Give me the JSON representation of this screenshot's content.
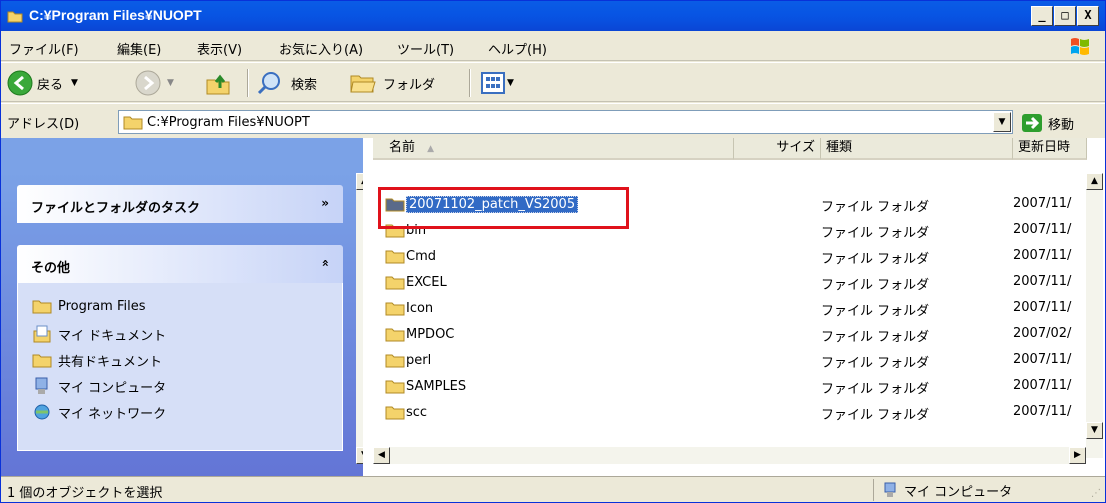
{
  "window": {
    "title": "C:¥Program Files¥NUOPT",
    "buttons": [
      "_",
      "□",
      "X"
    ]
  },
  "menu": [
    "ファイル(F)",
    "編集(E)",
    "表示(V)",
    "お気に入り(A)",
    "ツール(T)",
    "ヘルプ(H)"
  ],
  "toolbar": {
    "back": "戻る",
    "search": "検索",
    "folders": "フォルダ"
  },
  "address": {
    "label": "アドレス(D)",
    "value": "C:¥Program Files¥NUOPT",
    "go": "移動"
  },
  "tasks": {
    "file_folder_tasks": "ファイルとフォルダのタスク",
    "other": "その他",
    "other_items": [
      "Program Files",
      "マイ ドキュメント",
      "共有ドキュメント",
      "マイ コンピュータ",
      "マイ ネットワーク"
    ]
  },
  "columns": {
    "name": "名前",
    "size": "サイズ",
    "type": "種類",
    "modified": "更新日時"
  },
  "files": [
    {
      "name": "20071102_patch_VS2005",
      "type": "ファイル フォルダ",
      "date": "2007/11/"
    },
    {
      "name": "bin",
      "type": "ファイル フォルダ",
      "date": "2007/11/"
    },
    {
      "name": "Cmd",
      "type": "ファイル フォルダ",
      "date": "2007/11/"
    },
    {
      "name": "EXCEL",
      "type": "ファイル フォルダ",
      "date": "2007/11/"
    },
    {
      "name": "Icon",
      "type": "ファイル フォルダ",
      "date": "2007/11/"
    },
    {
      "name": "MPDOC",
      "type": "ファイル フォルダ",
      "date": "2007/02/"
    },
    {
      "name": "perl",
      "type": "ファイル フォルダ",
      "date": "2007/11/"
    },
    {
      "name": "SAMPLES",
      "type": "ファイル フォルダ",
      "date": "2007/11/"
    },
    {
      "name": "scc",
      "type": "ファイル フォルダ",
      "date": "2007/11/"
    }
  ],
  "status": {
    "left": "1 個のオブジェクトを選択",
    "right": "マイ コンピュータ"
  }
}
